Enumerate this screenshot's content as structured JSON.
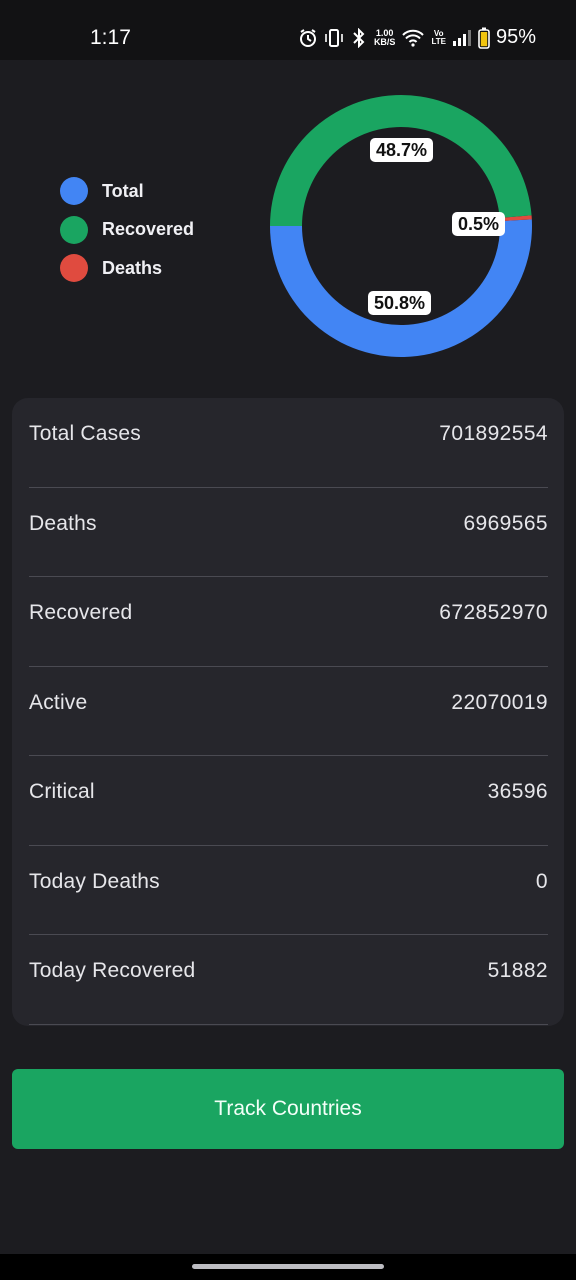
{
  "status": {
    "time": "1:17",
    "net_speed_value": "1.00",
    "net_speed_unit": "KB/S",
    "volte_top": "Vo",
    "volte_bottom": "LTE",
    "battery": "95%"
  },
  "legend": [
    {
      "label": "Total",
      "color": "#4285f4"
    },
    {
      "label": "Recovered",
      "color": "#1aa561"
    },
    {
      "label": "Deaths",
      "color": "#e04b3f"
    }
  ],
  "chart_data": {
    "type": "pie",
    "donut": true,
    "slices": [
      {
        "name": "Total",
        "percent": 50.8,
        "label": "50.8%",
        "color": "#4285f4"
      },
      {
        "name": "Recovered",
        "percent": 48.7,
        "label": "48.7%",
        "color": "#1aa561"
      },
      {
        "name": "Deaths",
        "percent": 0.5,
        "label": "0.5%",
        "color": "#e04b3f"
      }
    ]
  },
  "stats": [
    {
      "label": "Total Cases",
      "value": "701892554"
    },
    {
      "label": "Deaths",
      "value": "6969565"
    },
    {
      "label": "Recovered",
      "value": "672852970"
    },
    {
      "label": "Active",
      "value": "22070019"
    },
    {
      "label": "Critical",
      "value": "36596"
    },
    {
      "label": "Today Deaths",
      "value": "0"
    },
    {
      "label": "Today Recovered",
      "value": "51882"
    }
  ],
  "track_button": {
    "label": "Track Countries"
  }
}
